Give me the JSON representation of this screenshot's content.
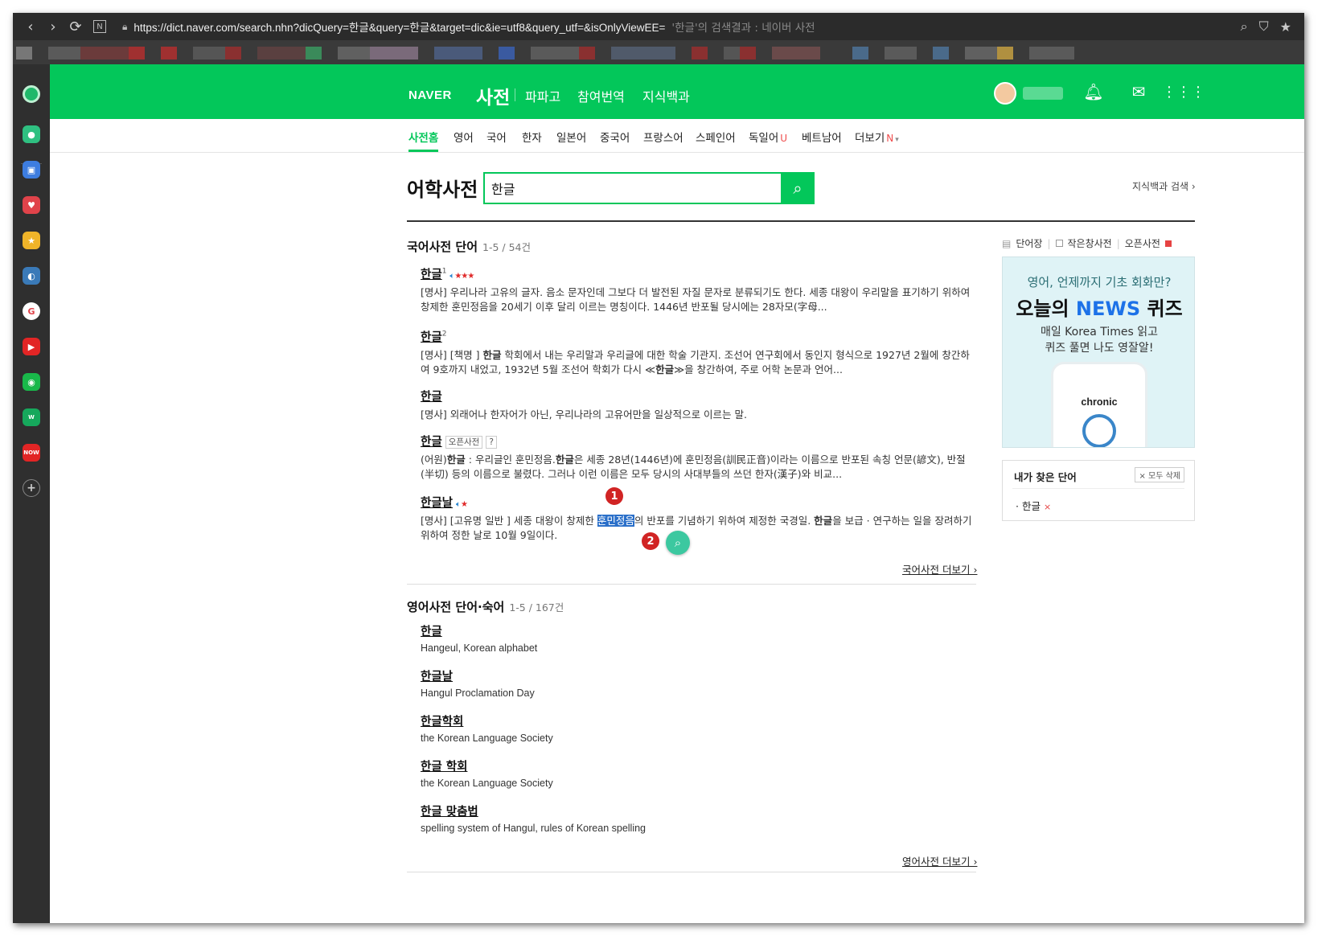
{
  "browser": {
    "url": "https://dict.naver.com/search.nhn?dicQuery=한글&query=한글&target=dic&ie=utf8&query_utf=&isOnlyViewEE=",
    "page_title": "'한글'의 검색결과 : 네이버 사전",
    "n_label": "N"
  },
  "header": {
    "logo": "NAVER",
    "title": "사전",
    "links": [
      "파파고",
      "참여번역",
      "지식백과"
    ]
  },
  "tabs": [
    "사전홈",
    "영어",
    "국어",
    "한자",
    "일본어",
    "중국어",
    "프랑스어",
    "스페인어",
    "독일어",
    "베트남어",
    "더보기"
  ],
  "tab_marks": {
    "german": "U",
    "more": "N"
  },
  "search": {
    "label": "어학사전",
    "value": "한글",
    "kb_search": "지식백과 검색 ›"
  },
  "korean_section": {
    "title": "국어사전 단어",
    "count": "1-5 / 54건",
    "entries": [
      {
        "word": "한글",
        "sup": "1",
        "def": "[명사] 우리나라 고유의 글자. 음소 문자인데 그보다 더 발전된 자질 문자로 분류되기도 한다. 세종 대왕이 우리말을 표기하기 위하여 창제한 훈민정음을 20세기 이후 달리 이르는 명칭이다. 1446년 반포될 당시에는 28자모(字母..."
      },
      {
        "word": "한글",
        "sup": "2",
        "def_a": "[명사] [책명 ] ",
        "def_b": "한글",
        "def_c": " 학회에서 내는 우리말과 우리글에 대한 학술 기관지. 조선어 연구회에서 동인지 형식으로 1927년 2월에 창간하여 9호까지 내었고, 1932년 5월 조선어 학회가 다시 ≪",
        "def_d": "한글",
        "def_e": "≫을 창간하여, 주로 어학 논문과 언어..."
      },
      {
        "word": "한글",
        "def": "[명사] 외래어나 한자어가 아닌, 우리나라의 고유어만을 일상적으로 이르는 말."
      },
      {
        "word": "한글",
        "tag1": "오픈사전",
        "tag2": "?",
        "def_a": "(어원)",
        "def_b": "한글",
        "def_c": " : 우리글인 훈민정음.",
        "def_d": "한글",
        "def_e": "은 세종 28년(1446년)에 훈민정음(訓民正音)이라는 이름으로 반포된 속칭 언문(諺文), 반절(半切) 등의 이름으로 불렸다. 그러나 이런 이름은 모두 당시의 사대부들의 쓰던 한자(漢子)와 비교..."
      },
      {
        "word": "한글날",
        "def_a": "[명사] [고유명 일반 ] 세종 대왕이 창제한 ",
        "def_hl": "훈민정음",
        "def_b": "의 반포를 기념하기 위하여 제정한 국경일. ",
        "def_c": "한글",
        "def_d": "을 보급 · 연구하는 일을 장려하기 위하여 정한 날로 10월 9일이다."
      }
    ],
    "more": "국어사전 더보기 ›"
  },
  "english_section": {
    "title": "영어사전 단어·숙어",
    "count": "1-5 / 167건",
    "entries": [
      {
        "word": "한글",
        "def": "Hangeul, Korean alphabet"
      },
      {
        "word": "한글날",
        "def": "Hangul Proclamation Day"
      },
      {
        "word": "한글학회",
        "def": "the Korean Language Society"
      },
      {
        "word": "한글 학회",
        "def": "the Korean Language Society"
      },
      {
        "word": "한글 맞춤법",
        "def": "spelling system of Hangul, rules of Korean spelling"
      }
    ],
    "more": "영어사전 더보기 ›"
  },
  "callouts": [
    "1",
    "2"
  ],
  "right": {
    "links": [
      "단어장",
      "작은창사전",
      "오픈사전"
    ],
    "ad": {
      "line1": "영어, 언제까지 기초 회화만?",
      "line2_a": "오늘의 ",
      "line2_b": "NEWS",
      "line2_c": " 퀴즈",
      "line3": "매일 Korea Times 읽고",
      "line4": "퀴즈 풀면 나도 영잘알!",
      "phone_word": "chronic"
    },
    "recent": {
      "title": "내가 찾은 단어",
      "delete": "× 모두 삭제",
      "word": "· 한글",
      "x": "×"
    }
  },
  "colors": {
    "naver_green": "#03c75a",
    "highlight": "#2a6fc9",
    "callout_red": "#d12424"
  }
}
